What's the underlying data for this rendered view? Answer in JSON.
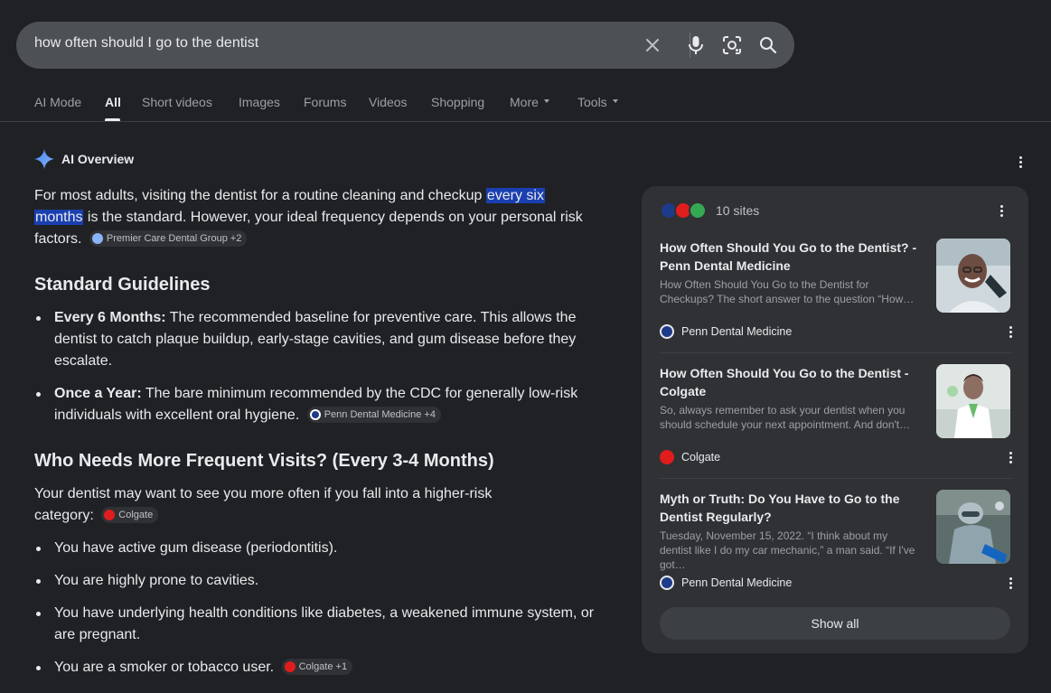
{
  "search": {
    "query": "how often should I go to the dentist"
  },
  "tabs": [
    {
      "label": "AI Mode"
    },
    {
      "label": "All"
    },
    {
      "label": "Short videos"
    },
    {
      "label": "Images"
    },
    {
      "label": "Forums"
    },
    {
      "label": "Videos"
    },
    {
      "label": "Shopping"
    },
    {
      "label": "More"
    },
    {
      "label": "Tools"
    }
  ],
  "overview": {
    "title": "AI Overview",
    "intro_pre": "For most adults, visiting the dentist for a routine cleaning and checkup ",
    "intro_hl1": "every six",
    "intro_hl2": "months",
    "intro_post": " is the standard. However, your ideal frequency depends on your personal risk factors.",
    "intro_chip": "Premier Care Dental Group +2",
    "section1": {
      "heading": "Standard Guidelines",
      "items": [
        {
          "bold": "Every 6 Months:",
          "text": " The recommended baseline for preventive care. This allows the dentist to catch plaque buildup, early-stage cavities, and gum disease before they escalate."
        },
        {
          "bold": "Once a Year:",
          "text": " The bare minimum recommended by the CDC for generally low-risk individuals with excellent oral hygiene.",
          "chip": "Penn Dental Medicine +4"
        }
      ]
    },
    "section2": {
      "heading": "Who Needs More Frequent Visits? (Every 3-4 Months)",
      "intro": "Your dentist may want to see you more often if you fall into a higher-risk category:",
      "intro_chip": "Colgate",
      "items": [
        {
          "text": "You have active gum disease (periodontitis)."
        },
        {
          "text": "You are highly prone to cavities."
        },
        {
          "text": "You have underlying health conditions like diabetes, a weakened immune system, or are pregnant."
        },
        {
          "text": "You are a smoker or tobacco user.",
          "chip": "Colgate +1"
        }
      ]
    }
  },
  "sources": {
    "count_label": "10 sites",
    "cards": [
      {
        "title": "How Often Should You Go to the Dentist? - Penn Dental Medicine",
        "snippet": "How Often Should You Go to the Dentist for Checkups? The short answer to the question “How…",
        "source": "Penn Dental Medicine"
      },
      {
        "title": "How Often Should You Go to the Dentist - Colgate",
        "snippet": "So, always remember to ask your dentist when you should schedule your next appointment. And don't…",
        "source": "Colgate"
      },
      {
        "title": "Myth or Truth: Do You Have to Go to the Dentist Regularly?",
        "snippet": "Tuesday, November 15, 2022. “I think about my dentist like I do my car mechanic,” a man said. “If I've got…",
        "source": "Penn Dental Medicine"
      }
    ],
    "show_all": "Show all"
  },
  "colors": {
    "background": "#202124",
    "panel": "#303134",
    "highlight": "#1a3fb0",
    "colgate": "#e01d1d",
    "penn": "#1e3a8a",
    "green": "#34a853"
  }
}
